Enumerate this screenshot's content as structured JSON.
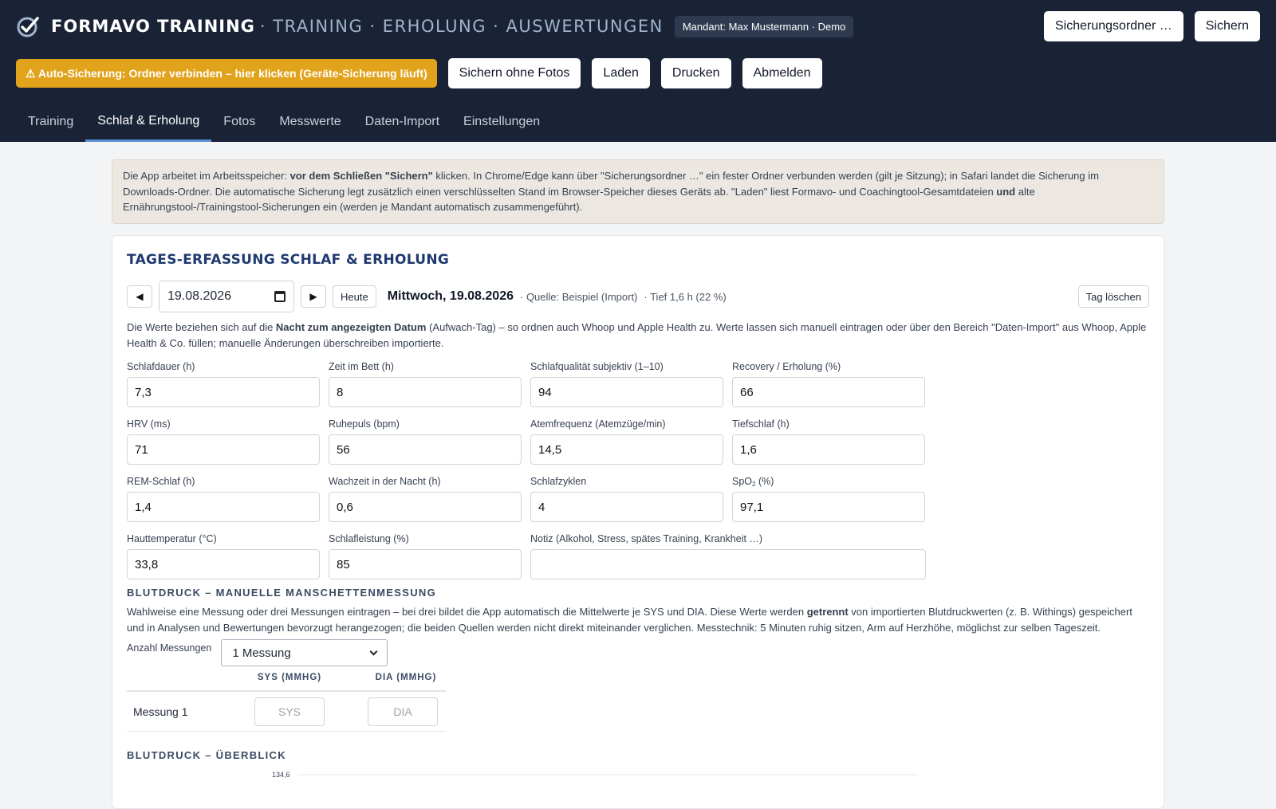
{
  "header": {
    "brand": "FORMAVO TRAINING",
    "brand_sub": "· TRAINING · ERHOLUNG · AUSWERTUNGEN",
    "mandant": "Mandant: Max Mustermann · Demo",
    "folder_button": "Sicherungsordner …",
    "save_button": "Sichern",
    "warning_button": "⚠ Auto-Sicherung: Ordner verbinden – hier klicken (Geräte-Sicherung läuft)",
    "actions": [
      "Sichern ohne Fotos",
      "Laden",
      "Drucken",
      "Abmelden"
    ],
    "tabs": [
      "Training",
      "Schlaf & Erholung",
      "Fotos",
      "Messwerte",
      "Daten-Import",
      "Einstellungen"
    ],
    "active_tab": "Schlaf & Erholung"
  },
  "info": {
    "part1": "Die App arbeitet im Arbeitsspeicher: ",
    "bold1": "vor dem Schließen \"Sichern\"",
    "part2": " klicken. In Chrome/Edge kann über \"Sicherungsordner …\" ein fester Ordner verbunden werden (gilt je Sitzung); in Safari landet die Sicherung im Downloads-Ordner. Die automatische Sicherung legt zusätzlich einen verschlüsselten Stand im Browser-Speicher dieses Geräts ab. \"Laden\" liest Formavo- und Coachingtool-Gesamtdateien ",
    "bold2": "und",
    "part3": " alte Ernährungstool-/Trainingstool-Sicherungen ein (werden je Mandant automatisch zusammengeführt)."
  },
  "card": {
    "title": "TAGES-ERFASSUNG SCHLAF & ERHOLUNG",
    "date_value": "19.08.2026",
    "today_button": "Heute",
    "day_label": "Mittwoch, 19.08.2026",
    "source": "· Quelle: Beispiel (Import)",
    "deep_meta": "· Tief 1,6 h (22 %)",
    "delete_button": "Tag löschen",
    "desc_part1": "Die Werte beziehen sich auf die ",
    "desc_bold": "Nacht zum angezeigten Datum",
    "desc_part2": " (Aufwach-Tag) – so ordnen auch Whoop und Apple Health zu. Werte lassen sich manuell eintragen oder über den Bereich \"Daten-Import\" aus Whoop, Apple Health & Co. füllen; manuelle Änderungen überschreiben importierte."
  },
  "fields": [
    {
      "label": "Schlafdauer (h)",
      "value": "7,3"
    },
    {
      "label": "Zeit im Bett (h)",
      "value": "8"
    },
    {
      "label": "Schlafqualität subjektiv (1–10)",
      "value": "94"
    },
    {
      "label": "Recovery / Erholung (%)",
      "value": "66"
    },
    {
      "label": "HRV (ms)",
      "value": "71"
    },
    {
      "label": "Ruhepuls (bpm)",
      "value": "56"
    },
    {
      "label": "Atemfrequenz (Atemzüge/min)",
      "value": "14,5"
    },
    {
      "label": "Tiefschlaf (h)",
      "value": "1,6"
    },
    {
      "label": "REM-Schlaf (h)",
      "value": "1,4"
    },
    {
      "label": "Wachzeit in der Nacht (h)",
      "value": "0,6"
    },
    {
      "label": "Schlafzyklen",
      "value": "4"
    },
    {
      "label": "SpO",
      "label_sub": "2",
      "label_after": " (%)",
      "value": "97,1"
    },
    {
      "label": "Hauttemperatur (°C)",
      "value": "33,8"
    },
    {
      "label": "Schlafleistung (%)",
      "value": "85"
    },
    {
      "label": "Notiz (Alkohol, Stress, spätes Training, Krankheit …)",
      "value": ""
    }
  ],
  "bp": {
    "heading": "BLUTDRUCK – MANUELLE MANSCHETTENMESSUNG",
    "desc_part1": "Wahlweise eine Messung oder drei Messungen eintragen – bei drei bildet die App automatisch die Mittelwerte je SYS und DIA. Diese Werte werden ",
    "desc_bold": "getrennt",
    "desc_part2": " von importierten Blutdruckwerten (z. B. Withings) gespeichert und in Analysen und Bewertungen bevorzugt herangezogen; die beiden Quellen werden nicht direkt miteinander verglichen. Messtechnik: 5 Minuten ruhig sitzen, Arm auf Herzhöhe, möglichst zur selben Tageszeit.",
    "count_label": "Anzahl Messungen",
    "count_value": "1 Messung",
    "col_sys": "SYS (MMHG)",
    "col_dia": "DIA (MMHG)",
    "row_label": "Messung 1",
    "sys_placeholder": "SYS",
    "dia_placeholder": "DIA",
    "overview_heading": "BLUTDRUCK – ÜBERBLICK",
    "chart_top_tick": "134,6"
  }
}
